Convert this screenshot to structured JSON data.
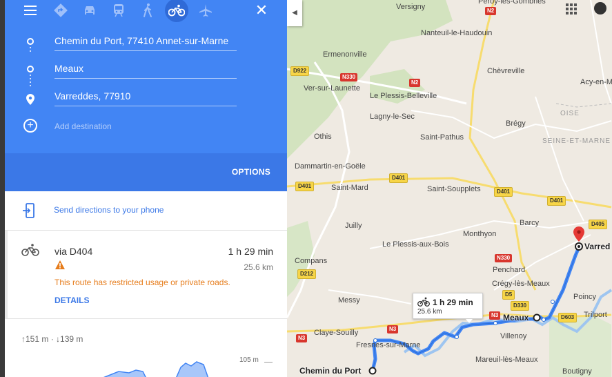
{
  "topbar": {
    "menu_icon": "menu-icon",
    "modes": [
      {
        "name": "best-travel-mode",
        "icon": "diamond-turn-icon"
      },
      {
        "name": "driving",
        "icon": "car-icon"
      },
      {
        "name": "transit",
        "icon": "train-icon"
      },
      {
        "name": "walking",
        "icon": "walk-icon"
      },
      {
        "name": "cycling",
        "icon": "bike-icon",
        "active": true
      },
      {
        "name": "flights",
        "icon": "plane-icon"
      }
    ],
    "close_icon": "close-icon"
  },
  "stops": [
    {
      "value": "Chemin du Port, 77410 Annet-sur-Marne"
    },
    {
      "value": "Meaux"
    },
    {
      "value": "Varreddes, 77910"
    }
  ],
  "add_destination": "Add destination",
  "options_label": "OPTIONS",
  "send_directions": "Send directions to your phone",
  "route": {
    "via": "via D404",
    "duration": "1 h 29 min",
    "distance": "25.6 km",
    "warning": "This route has restricted usage or private roads.",
    "details": "DETAILS"
  },
  "elevation": {
    "ascent": "151 m",
    "descent": "139 m",
    "separator": "·",
    "max_label": "105 m"
  },
  "map": {
    "collapse_icon": "chevron-left-icon",
    "callout": {
      "duration": "1 h 29 min",
      "distance": "25.6 km"
    },
    "places": {
      "versigny": "Versigny",
      "peroy": "Peroy-les-Gombries",
      "nanteuil": "Nanteuil-le-Haudouin",
      "ermenonville": "Ermenonville",
      "chevreville": "Chèvreville",
      "ver": "Ver-sur-Launette",
      "plessis_belleville": "Le Plessis-Belleville",
      "acy": "Acy-en-M",
      "lagny": "Lagny-le-Sec",
      "oise": "OISE",
      "othis": "Othis",
      "bregy": "Brégy",
      "saint_pathus": "Saint-Pathus",
      "seine_et_marne": "SEINE-ET-MARNE",
      "dammartin": "Dammartin-en-Goële",
      "saint_mard": "Saint-Mard",
      "saint_soupplets": "Saint-Soupplets",
      "barcy": "Barcy",
      "juilly": "Juilly",
      "monthyon": "Monthyon",
      "plessis_bois": "Le Plessis-aux-Bois",
      "compans": "Compans",
      "penchard": "Penchard",
      "cregy": "Crégy-lès-Meaux",
      "poincy": "Poincy",
      "messy": "Messy",
      "trilport": "Trilport",
      "claye": "Claye-Souilly",
      "villenoy": "Villenoy",
      "fresnes": "Fresnes-sur-Marne",
      "mareuil": "Mareuil-lès-Meaux",
      "boutigny": "Boutigny",
      "meaux": "Meaux",
      "varreddes": "Varred",
      "chemin": "Chemin du Port"
    },
    "shields": {
      "n2a": "N2",
      "d922": "D922",
      "n330a": "N330",
      "n2b": "N2",
      "d401a": "D401",
      "d401b": "D401",
      "d401c": "D401",
      "d401d": "D401",
      "d405": "D405",
      "n330b": "N330",
      "d212": "D212",
      "d330": "D330",
      "d5": "D5",
      "n3a": "N3",
      "d603": "D603",
      "n3b": "N3",
      "n3c": "N3"
    }
  }
}
